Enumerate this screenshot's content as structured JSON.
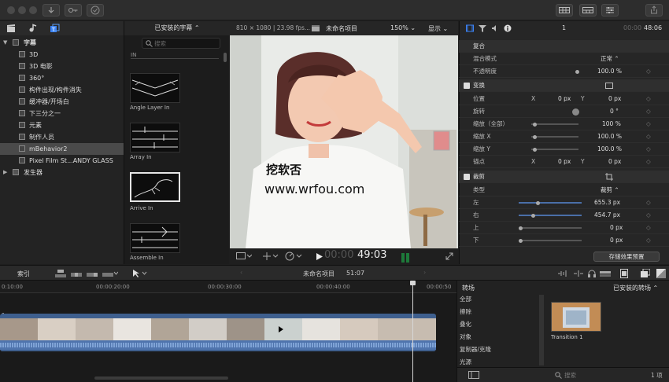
{
  "titlebar": {
    "buttons": [
      "download-icon",
      "key-icon",
      "check-icon"
    ],
    "right_buttons": [
      "grid-icon",
      "grid2-icon",
      "sliders-icon",
      "share-icon"
    ]
  },
  "library": {
    "items": [
      {
        "label": "字幕",
        "level": 0
      },
      {
        "label": "3D",
        "level": 1
      },
      {
        "label": "3D 电影",
        "level": 1
      },
      {
        "label": "360°",
        "level": 1
      },
      {
        "label": "构件出现/构件消失",
        "level": 1
      },
      {
        "label": "缓冲器/开场白",
        "level": 1
      },
      {
        "label": "下三分之一",
        "level": 1
      },
      {
        "label": "元素",
        "level": 1
      },
      {
        "label": "制作人员",
        "level": 1
      },
      {
        "label": "mBehavior2",
        "level": 1,
        "selected": true
      },
      {
        "label": "Pixel Film St...ANDY GLASS",
        "level": 1
      },
      {
        "label": "发生器",
        "level": 0
      }
    ]
  },
  "browser": {
    "dropdown": "已安装的字幕 ⌃",
    "search_placeholder": "搜索",
    "section": "IN",
    "items": [
      {
        "label": "Angle Layer In"
      },
      {
        "label": "Array In"
      },
      {
        "label": "Arrive In"
      },
      {
        "label": "Assemble In"
      }
    ]
  },
  "viewer": {
    "info": "810 × 1080 | 23.98 fps...",
    "project": "未命名项目",
    "zoom": "150% ⌄",
    "display": "显示 ⌄",
    "watermark_cn": "挖软否",
    "watermark_url": "www.wrfou.com",
    "timecode_dim": "00:00",
    "timecode": "49:03"
  },
  "inspector": {
    "counter": "1",
    "timecode_dim": "00:00",
    "timecode": "48:06",
    "sections": {
      "composite": "复合",
      "blend_label": "混合模式",
      "blend_value": "正常 ⌃",
      "opacity_label": "不透明度",
      "opacity_value": "100.0 %",
      "transform": "变换",
      "position_label": "位置",
      "position_x": "0 px",
      "position_y": "0 px",
      "rotation_label": "旋转",
      "rotation_value": "0 °",
      "scale_all_label": "缩放（全部）",
      "scale_all_value": "100 %",
      "scale_x_label": "缩放 X",
      "scale_x_value": "100.0 %",
      "scale_y_label": "缩放 Y",
      "scale_y_value": "100.0 %",
      "anchor_label": "锚点",
      "anchor_x": "0 px",
      "anchor_y": "0 px",
      "crop": "裁剪",
      "type_label": "类型",
      "type_value": "裁剪 ⌃",
      "left_label": "左",
      "left_value": "655.3 px",
      "right_label": "右",
      "right_value": "454.7 px",
      "top_label": "上",
      "top_value": "0 px",
      "bottom_label": "下",
      "bottom_value": "0 px",
      "x": "X",
      "y": "Y"
    },
    "save_button": "存储效果预置"
  },
  "timeline": {
    "index": "索引",
    "project": "未命名项目",
    "duration": "51:07",
    "ruler": [
      "0:10:00",
      "00:00:20:00",
      "00:00:30:00",
      "00:00:40:00",
      "00:00:50"
    ],
    "track_label": "1"
  },
  "transitions": {
    "title": "转场",
    "dropdown": "已安装的转场 ⌃",
    "categories": [
      "全部",
      "擦除",
      "叠化",
      "对象",
      "复制器/克隆",
      "光源"
    ],
    "item": "Transition 1",
    "search_placeholder": "搜索",
    "count": "1 项"
  },
  "colors": {
    "accent_blue": "#3b82f6",
    "clip_blue": "#3e5f8e",
    "playhead": "#d7d7d7"
  }
}
